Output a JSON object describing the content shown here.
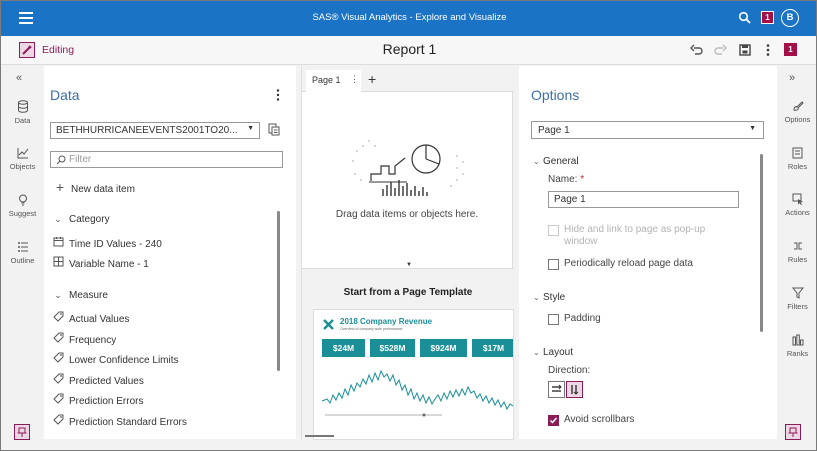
{
  "app": {
    "title": "SAS® Visual Analytics - Explore and Visualize",
    "notification_count": "1",
    "user_initial": "B"
  },
  "toolbar": {
    "mode_label": "Editing",
    "report_title": "Report 1",
    "badge": "1"
  },
  "left_rail": {
    "items": [
      {
        "label": "Data",
        "icon": "database-icon"
      },
      {
        "label": "Objects",
        "icon": "chart-icon"
      },
      {
        "label": "Suggest",
        "icon": "lightbulb-icon"
      },
      {
        "label": "Outline",
        "icon": "list-icon"
      }
    ]
  },
  "data_pane": {
    "title": "Data",
    "data_source": "BETHHURRICANEEVENTS2001TO20...",
    "filter_placeholder": "Filter",
    "new_item_label": "New data item",
    "category_label": "Category",
    "category_items": [
      "Time ID Values - 240",
      "Variable Name - 1"
    ],
    "measure_label": "Measure",
    "measure_items": [
      "Actual Values",
      "Frequency",
      "Lower Confidence Limits",
      "Predicted Values",
      "Prediction Errors",
      "Prediction Standard Errors"
    ]
  },
  "canvas": {
    "tab_label": "Page 1",
    "drop_text": "Drag data items or objects here.",
    "template_heading": "Start from a Page Template",
    "template": {
      "title": "2018 Company Revenue",
      "subtitle": "Overview of company wide performance",
      "kpis": [
        "$24M",
        "$528M",
        "$924M",
        "$17M"
      ]
    }
  },
  "options_pane": {
    "title": "Options",
    "page_select": "Page 1",
    "general_label": "General",
    "name_label": "Name:",
    "required_marker": "*",
    "name_value": "Page 1",
    "hide_link_label": "Hide and link to page as pop-up window",
    "reload_label": "Periodically reload page data",
    "style_label": "Style",
    "padding_label": "Padding",
    "layout_label": "Layout",
    "direction_label": "Direction:",
    "avoid_scrollbars_label": "Avoid scrollbars"
  },
  "right_rail": {
    "items": [
      {
        "label": "Options",
        "icon": "brush-icon"
      },
      {
        "label": "Roles",
        "icon": "roles-icon"
      },
      {
        "label": "Actions",
        "icon": "actions-icon"
      },
      {
        "label": "Rules",
        "icon": "rules-icon"
      },
      {
        "label": "Filters",
        "icon": "filter-icon"
      },
      {
        "label": "Ranks",
        "icon": "ranks-icon"
      }
    ]
  },
  "colors": {
    "header": "#1b73c6",
    "accent": "#8a1c5a",
    "pane_title": "#3c6fa5",
    "kpi_teal": "#1a8f97"
  }
}
